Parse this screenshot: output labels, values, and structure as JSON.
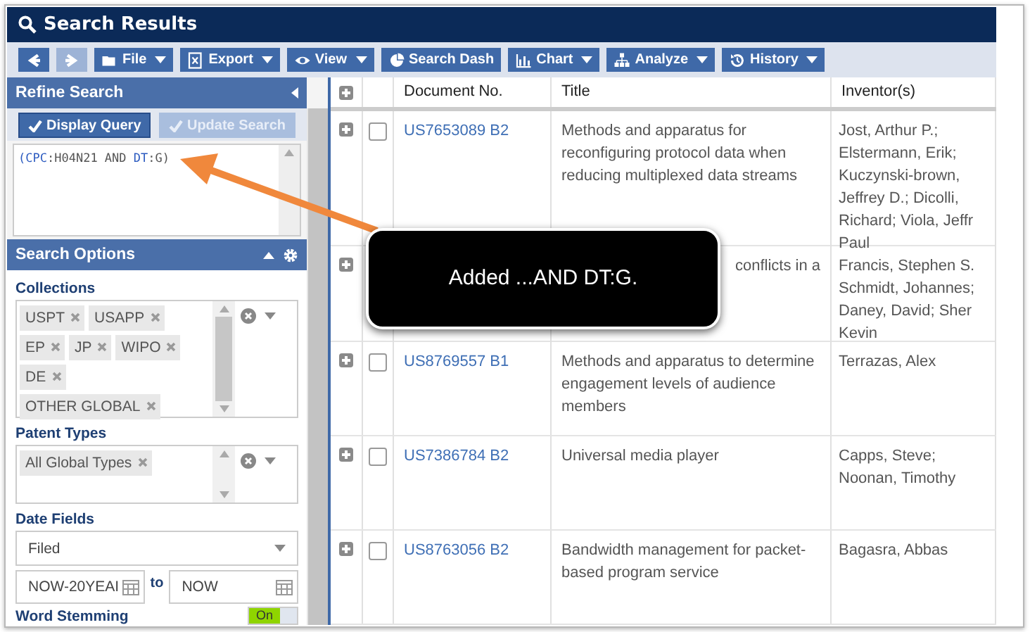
{
  "window": {
    "title": "Search Results"
  },
  "toolbar": [
    {
      "kind": "back",
      "disabled": false
    },
    {
      "kind": "forward",
      "disabled": true
    },
    {
      "kind": "folder",
      "label": "File",
      "has_menu": true
    },
    {
      "kind": "export",
      "label": "Export",
      "has_menu": true
    },
    {
      "kind": "eye",
      "label": "View",
      "has_menu": true
    },
    {
      "kind": "pie",
      "label": "Search Dash",
      "has_menu": false
    },
    {
      "kind": "bars",
      "label": "Chart",
      "has_menu": true
    },
    {
      "kind": "tree",
      "label": "Analyze",
      "has_menu": true
    },
    {
      "kind": "history",
      "label": "History",
      "has_menu": true
    }
  ],
  "refine": {
    "title": "Refine Search",
    "buttons": [
      {
        "label": "Display Query",
        "disabled": false
      },
      {
        "label": "Update Search",
        "disabled": true
      }
    ],
    "query_tokens": [
      {
        "kind": "field",
        "text": "("
      },
      {
        "kind": "field",
        "text": "CPC"
      },
      {
        "kind": "plain",
        "text": ":H04N21 AND "
      },
      {
        "kind": "field",
        "text": "DT"
      },
      {
        "kind": "plain",
        "text": ":G)"
      }
    ]
  },
  "search_options": {
    "title": "Search Options",
    "collections": {
      "label": "Collections",
      "tags": [
        "USPT",
        "USAPP",
        "EP",
        "JP",
        "WIPO",
        "DE",
        "OTHER GLOBAL"
      ]
    },
    "patent_types": {
      "label": "Patent Types",
      "tags": [
        "All Global Types"
      ]
    },
    "date_fields": {
      "label": "Date Fields",
      "field": "Filed",
      "from": "NOW-20YEAI",
      "to_label": "to",
      "to": "NOW"
    },
    "word_stemming": {
      "label": "Word Stemming",
      "on": true,
      "on_label": "On"
    }
  },
  "table": {
    "columns": [
      "Document No.",
      "Title",
      "Inventor(s)"
    ],
    "rows": [
      {
        "doc": "US7653089 B2",
        "title": "Methods and apparatus for reconfiguring protocol data when reducing multiplexed data streams",
        "inventors": [
          "Jost, Arthur P.;",
          "Elstermann, Erik;",
          "Kuczynski-brown,",
          "Jeffrey D.; Dicolli,",
          "Richard; Viola, Jeffr",
          "Paul"
        ],
        "checked": false
      },
      {
        "title_fragment": "conflicts in a",
        "inventors": [
          "Francis, Stephen S.",
          "Schmidt, Johannes;",
          "Daney, David; Sher",
          "Kevin"
        ]
      },
      {
        "doc": "US8769557 B1",
        "title": "Methods and apparatus to determine engagement levels of audience members",
        "inventors": [
          "Terrazas, Alex"
        ],
        "checked": false
      },
      {
        "doc": "US7386784 B2",
        "title": "Universal media player",
        "inventors": [
          "Capps, Steve;",
          "Noonan, Timothy"
        ],
        "checked": false
      },
      {
        "doc": "US8763056 B2",
        "title": "Bandwidth management for packet-based program service",
        "inventors": [
          "Bagasra, Abbas"
        ],
        "checked": false
      }
    ]
  },
  "callout": {
    "text": "Added ...AND DT:G."
  }
}
